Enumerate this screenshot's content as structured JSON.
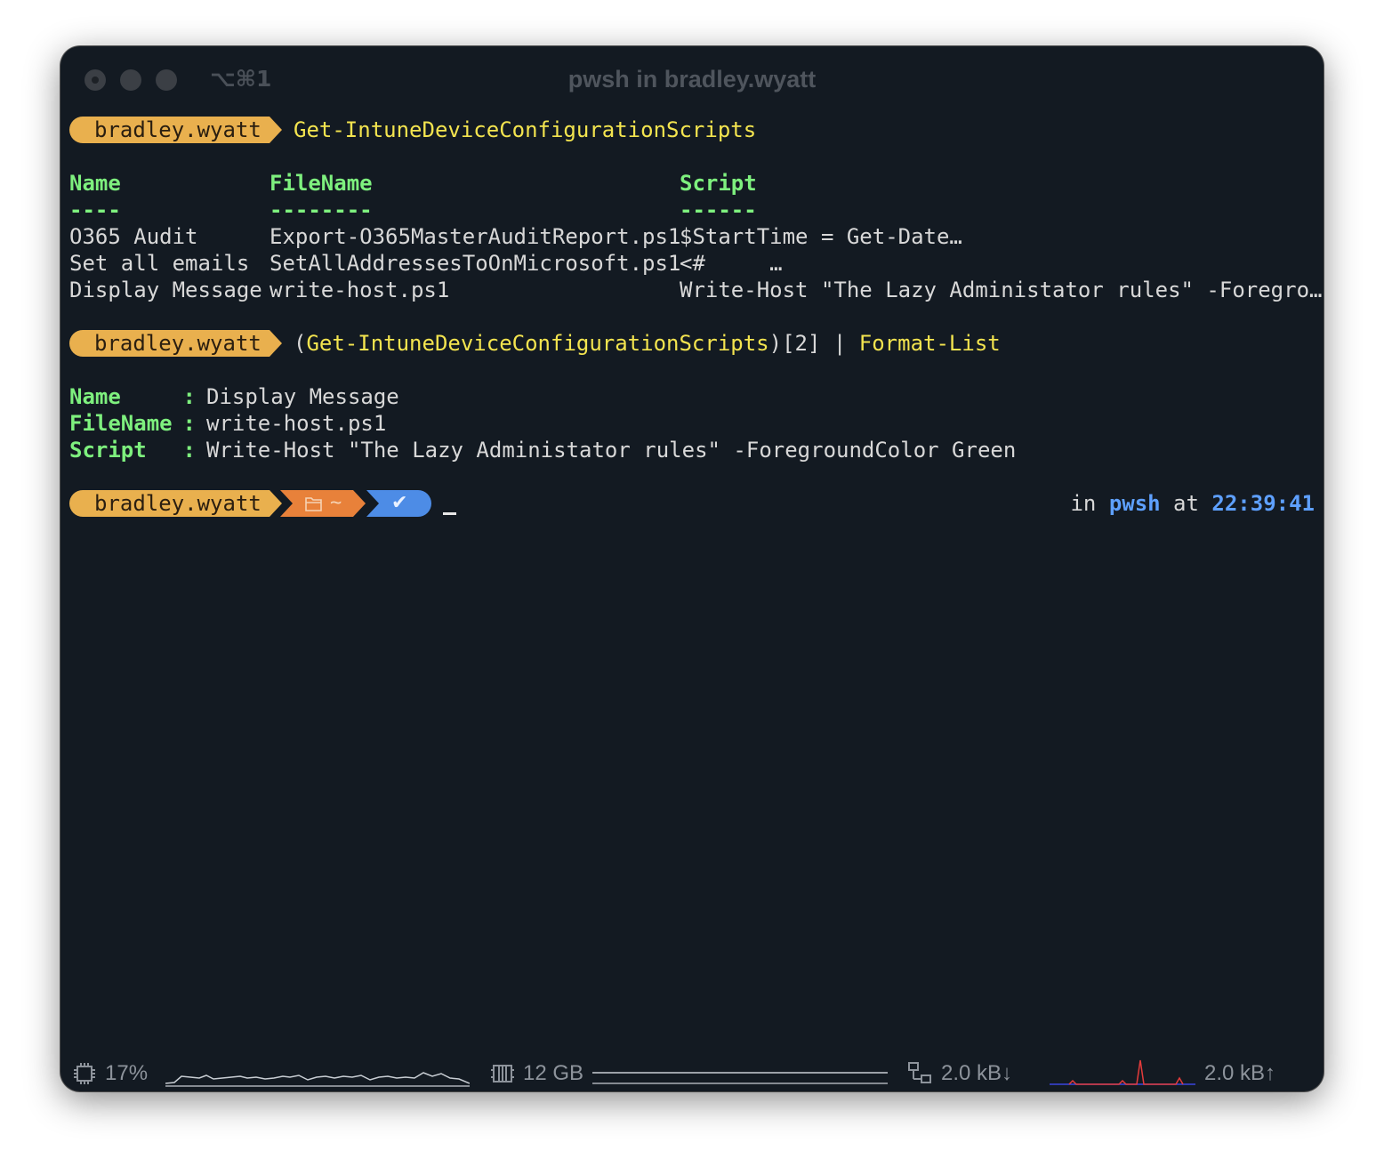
{
  "window": {
    "title": "pwsh in bradley.wyatt",
    "shortcut": "⌥⌘1"
  },
  "prompt": {
    "user": "bradley.wyatt",
    "folder": "~",
    "status_glyph": "✔"
  },
  "commands": [
    {
      "text": "Get-IntuneDeviceConfigurationScripts"
    },
    {
      "paren_open": "(",
      "cmdlet": "Get-IntuneDeviceConfigurationScripts",
      "index": ")[2] | ",
      "pipe_cmd": "Format-List"
    }
  ],
  "table": {
    "headers": [
      "Name",
      "FileName",
      "Script"
    ],
    "underlines": [
      "----",
      "--------",
      "------"
    ],
    "rows": [
      [
        "O365 Audit",
        "Export-O365MasterAuditReport.ps1",
        "$StartTime = Get-Date…"
      ],
      [
        "Set all emails",
        "SetAllAddressesToOnMicrosoft.ps1",
        "<#     …"
      ],
      [
        "Display Message",
        "write-host.ps1",
        "Write-Host \"The Lazy Administator rules\" -Foregro…"
      ]
    ]
  },
  "list": [
    {
      "key": "Name",
      "sep": " : ",
      "value": "Display Message"
    },
    {
      "key": "FileName",
      "sep": " : ",
      "value": "write-host.ps1"
    },
    {
      "key": "Script",
      "sep": " : ",
      "value": "Write-Host \"The Lazy Administator rules\" -ForegroundColor Green"
    }
  ],
  "right_prompt": {
    "in": "in ",
    "shell": "pwsh",
    "at": " at ",
    "time": "22:39:41"
  },
  "statusbar": {
    "cpu": "17%",
    "memory": "12 GB",
    "net_down": "2.0 kB↓",
    "net_up": "2.0 kB↑"
  },
  "colors": {
    "background": "#131a22",
    "user_segment": "#e9b04e",
    "folder_segment": "#e8813a",
    "status_segment": "#4d8ce6",
    "header_green": "#7ef07e",
    "command_yellow": "#f3e44f",
    "accent_blue": "#5ea0ff"
  }
}
